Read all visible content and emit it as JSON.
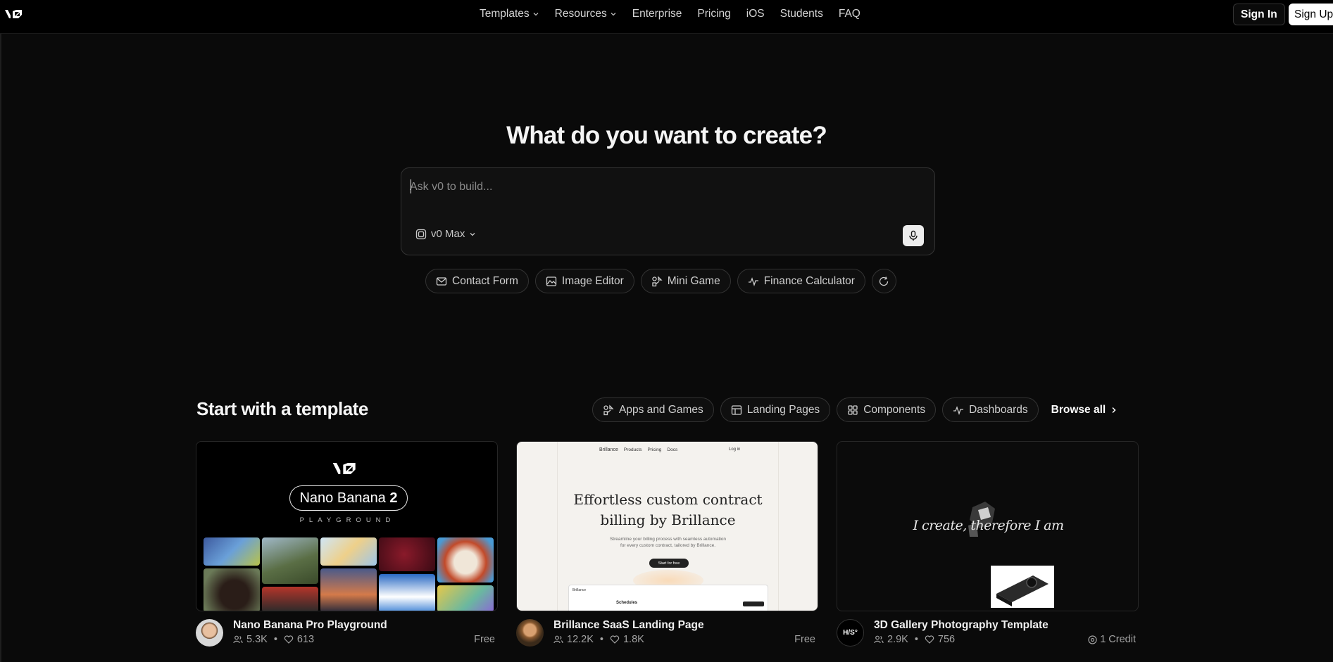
{
  "header": {
    "logo": "v0",
    "nav": [
      {
        "label": "Templates",
        "has_dropdown": true
      },
      {
        "label": "Resources",
        "has_dropdown": true
      },
      {
        "label": "Enterprise",
        "has_dropdown": false
      },
      {
        "label": "Pricing",
        "has_dropdown": false
      },
      {
        "label": "iOS",
        "has_dropdown": false
      },
      {
        "label": "Students",
        "has_dropdown": false
      },
      {
        "label": "FAQ",
        "has_dropdown": false
      }
    ],
    "sign_in": "Sign In",
    "sign_up": "Sign Up"
  },
  "hero": {
    "title": "What do you want to create?",
    "prompt_placeholder": "Ask v0 to build...",
    "prompt_value": "",
    "model": "v0 Max",
    "suggestions": [
      "Contact Form",
      "Image Editor",
      "Mini Game",
      "Finance Calculator"
    ]
  },
  "templates": {
    "title": "Start with a template",
    "categories": [
      "Apps and Games",
      "Landing Pages",
      "Components",
      "Dashboards"
    ],
    "browse_all": "Browse all",
    "cards": [
      {
        "title": "Nano Banana Pro Playground",
        "users": "5.3K",
        "likes": "613",
        "price": "Free",
        "thumb": {
          "logo": "v0",
          "pill_text": "Nano Banana ",
          "pill_bold": "2",
          "subtitle": "PLAYGROUND"
        }
      },
      {
        "title": "Brillance SaaS Landing Page",
        "users": "12.2K",
        "likes": "1.8K",
        "price": "Free",
        "thumb": {
          "brand": "Brillance",
          "nav_links": [
            "Products",
            "Pricing",
            "Docs"
          ],
          "login": "Log in",
          "headline_1": "Effortless custom contract",
          "headline_2": "billing by Brillance",
          "sub_1": "Streamline your billing process with seamless automation",
          "sub_2": "for every custom contract, tailored by Brillance.",
          "cta": "Start for free",
          "panel_brand": "Brillance",
          "panel_title": "Schedules"
        }
      },
      {
        "title": "3D Gallery Photography Template",
        "users": "2.9K",
        "likes": "756",
        "price": "1 Credit",
        "avatar_text": "H/S°",
        "thumb": {
          "quote": "I create, therefore I am"
        }
      }
    ]
  },
  "colors": {
    "background": "#0a0a0a",
    "header_bg": "#000000",
    "border": "#333333",
    "text_muted": "#a3a3a3"
  }
}
